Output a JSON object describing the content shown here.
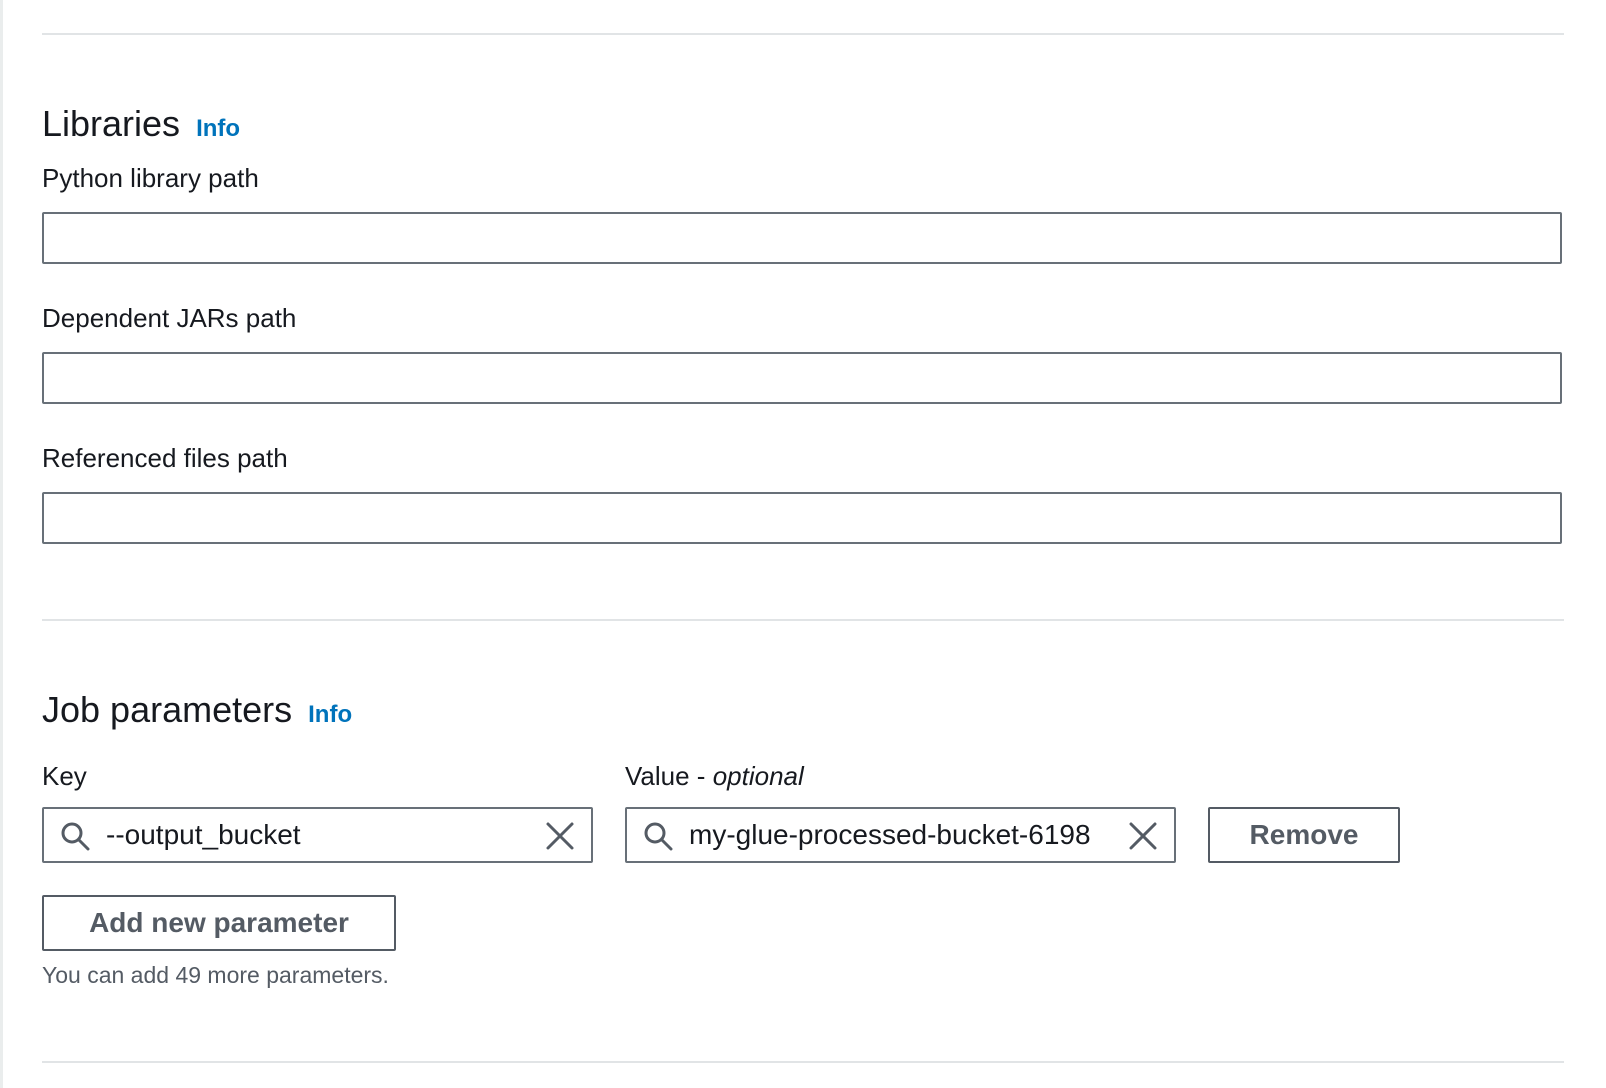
{
  "libraries": {
    "heading": "Libraries",
    "info_label": "Info",
    "python_library_path": {
      "label": "Python library path",
      "value": ""
    },
    "dependent_jars_path": {
      "label": "Dependent JARs path",
      "value": ""
    },
    "referenced_files_path": {
      "label": "Referenced files path",
      "value": ""
    }
  },
  "job_parameters": {
    "heading": "Job parameters",
    "info_label": "Info",
    "key_label": "Key",
    "value_label": "Value - ",
    "value_label_optional": "optional",
    "rows": [
      {
        "key": "--output_bucket",
        "value": "my-glue-processed-bucket-6198"
      }
    ],
    "remove_label": "Remove",
    "add_label": "Add new parameter",
    "hint": "You can add 49 more parameters."
  },
  "icons": {
    "search": "search-icon",
    "clear": "close-icon"
  },
  "colors": {
    "link": "#0073bb",
    "text": "#16191f",
    "secondary_text": "#545b64",
    "input_border": "#687078",
    "divider": "#e1e4e6"
  }
}
